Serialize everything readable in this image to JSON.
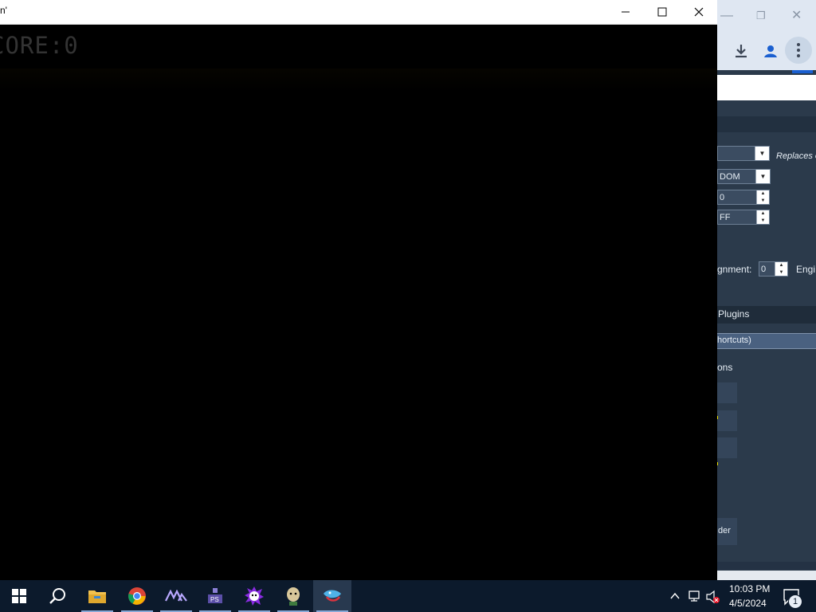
{
  "game_window": {
    "title": "n'",
    "score_text": "CORE:0"
  },
  "background_app": {
    "replaces_note": "Replaces o",
    "dropdown_random_value": "DOM",
    "spinner_1_value": "0",
    "spinner_2_value": "FF",
    "alignment_label": "gnment:",
    "alignment_value": "0",
    "engine_label": "Engi",
    "plugins_header": "Plugins",
    "shortcuts_label": "hortcuts)",
    "options_label": "ons",
    "folder_button_label": "der"
  },
  "taskbar": {
    "items": [
      "start",
      "search",
      "file-explorer",
      "chrome",
      "app-a",
      "app-b",
      "app-c",
      "app-d",
      "app-e"
    ],
    "clock_time": "10:03 PM",
    "clock_date": "4/5/2024",
    "notification_count": "1"
  },
  "colors": {
    "taskbar_bg": "#0c1a2c",
    "game_bg": "#000000",
    "settings_bg": "#2b3a4b",
    "accent_yellow": "#e8d800"
  }
}
